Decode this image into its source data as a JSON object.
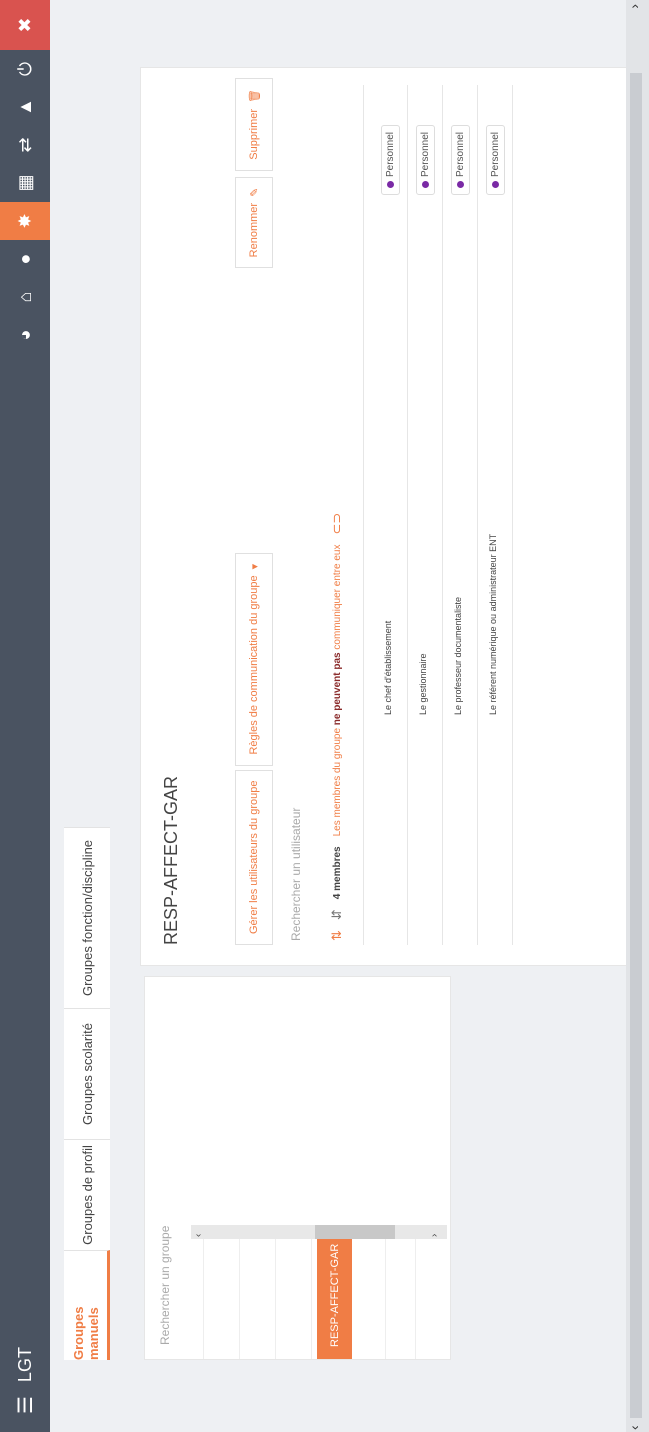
{
  "topbar": {
    "menu_icon": "hamburger-icon",
    "school_label": "LGT",
    "icons": [
      "pie-chart-icon",
      "house-user-icon",
      "user-icon",
      "groups-icon",
      "grid-icon",
      "transfer-icon",
      "warning-icon",
      "power-icon",
      "close-icon"
    ]
  },
  "tabs": [
    "Groupes manuels",
    "Groupes de profil",
    "Groupes scolarité",
    "Groupes fonction/discipline"
  ],
  "left_panel": {
    "search_placeholder": "Rechercher un groupe",
    "selected_group": "RESP-AFFECT-GAR"
  },
  "group": {
    "title": "RESP-AFFECT-GAR",
    "manage_users_label": "Gérer les utilisateurs du groupe",
    "comm_rules_label": "Règles de communication du groupe",
    "rename_label": "Renommer",
    "delete_label": "Supprimer",
    "user_search_placeholder": "Rechercher un utilisateur",
    "members_count": "4 membres",
    "comm_warning_prefix": "Les membres du groupe",
    "comm_warning_bold": "ne peuvent pas",
    "comm_warning_suffix": "communiquer entre eux",
    "members": [
      {
        "name": "Le chef d'établissement",
        "profile": "Personnel"
      },
      {
        "name": "Le gestionnaire",
        "profile": "Personnel"
      },
      {
        "name": "Le professeur documentaliste",
        "profile": "Personnel"
      },
      {
        "name": "Le référent numérique ou administrateur ENT",
        "profile": "Personnel"
      }
    ]
  }
}
